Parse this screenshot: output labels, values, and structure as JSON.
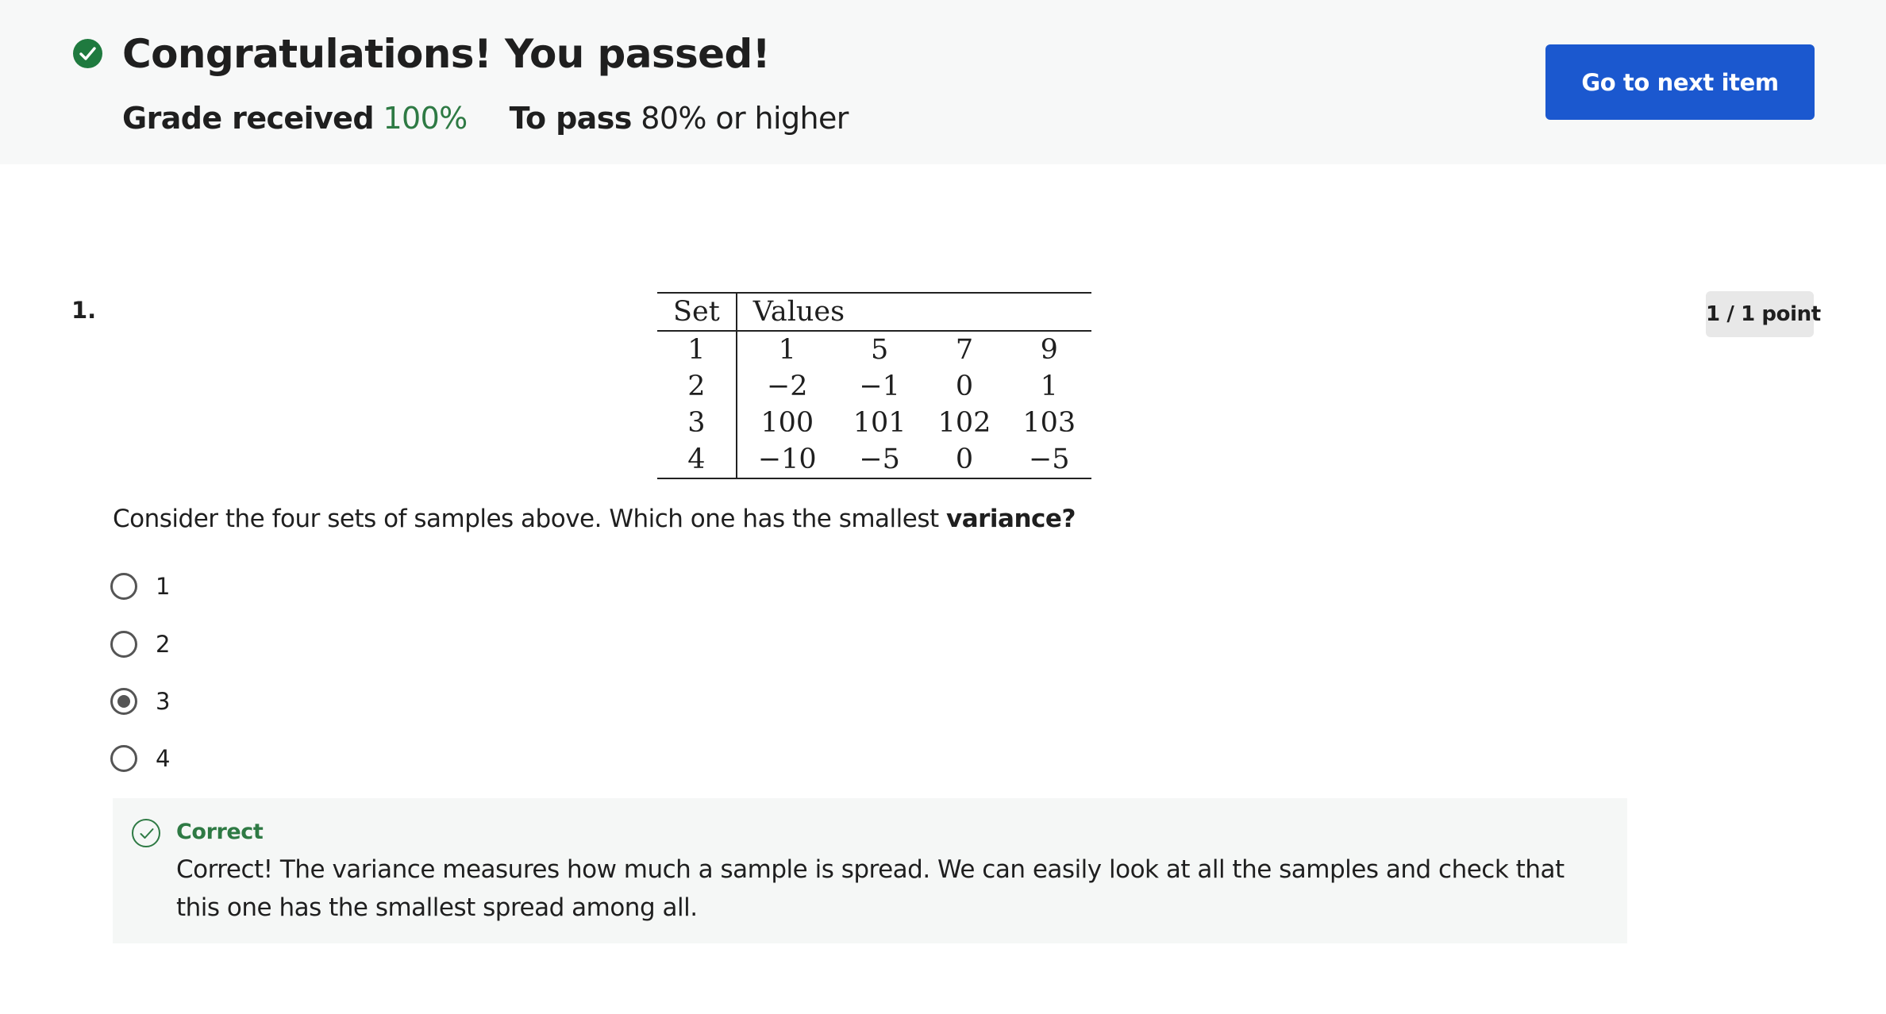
{
  "banner": {
    "title": "Congratulations! You passed!",
    "grade_label": "Grade received",
    "grade_value": "100%",
    "pass_label": "To pass",
    "pass_value": "80% or higher",
    "next_button": "Go to next item",
    "success_color": "#1f7a3f",
    "button_color": "#1b58cf"
  },
  "question": {
    "number": "1.",
    "points": "1 / 1 point",
    "table": {
      "headers": [
        "Set",
        "Values"
      ],
      "rows": [
        [
          "1",
          "1",
          "5",
          "7",
          "9"
        ],
        [
          "2",
          "−2",
          "−1",
          "0",
          "1"
        ],
        [
          "3",
          "100",
          "101",
          "102",
          "103"
        ],
        [
          "4",
          "−10",
          "−5",
          "0",
          "−5"
        ]
      ]
    },
    "text_prefix": "Consider the four sets of samples above. Which one has the smallest ",
    "text_bold": "variance?",
    "options": [
      {
        "label": "1",
        "selected": false
      },
      {
        "label": "2",
        "selected": false
      },
      {
        "label": "3",
        "selected": true
      },
      {
        "label": "4",
        "selected": false
      }
    ],
    "feedback": {
      "title": "Correct",
      "text": "Correct! The variance measures how much a sample is spread. We can easily look at all the samples and check that this one has the smallest spread among all."
    }
  }
}
